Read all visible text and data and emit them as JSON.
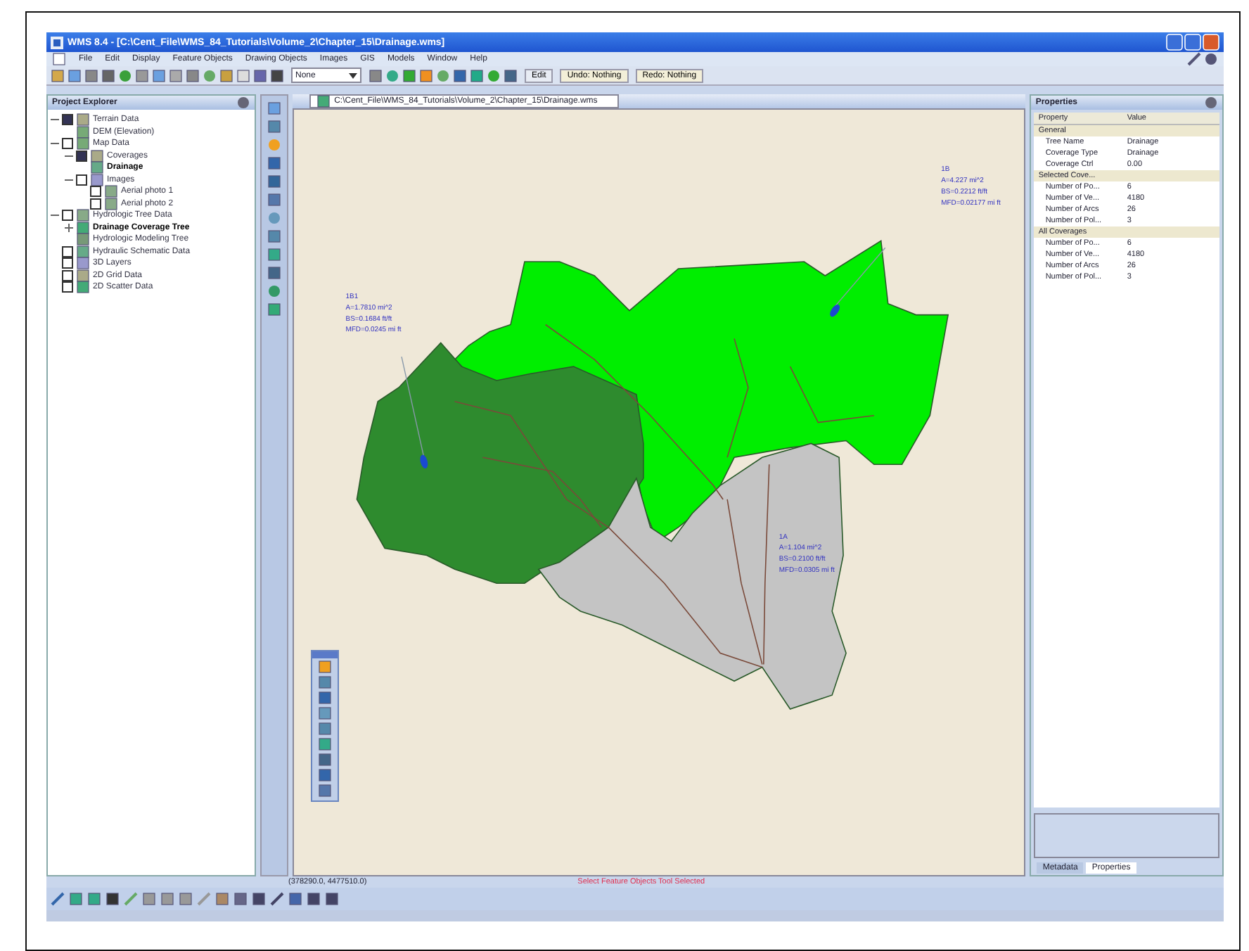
{
  "window": {
    "title": "WMS 8.4 - [C:\\Cent_File\\WMS_84_Tutorials\\Volume_2\\Chapter_15\\Drainage.wms]"
  },
  "menu": [
    "File",
    "Edit",
    "Display",
    "Feature Objects",
    "Drawing Objects",
    "Images",
    "GIS",
    "Models",
    "Window",
    "Help"
  ],
  "toolbar": {
    "dropdown": {
      "value": "None"
    },
    "buttons": [
      "Edit",
      "Undo: Nothing",
      "Redo: Nothing"
    ]
  },
  "project_explorer": {
    "title": "Project Explorer",
    "items": [
      {
        "label": "Terrain Data",
        "checked": true,
        "expanded": true,
        "active": false,
        "children": [
          {
            "label": "DEM (Elevation)",
            "active": false
          }
        ]
      },
      {
        "label": "Map Data",
        "checked": false,
        "expanded": true,
        "active": false,
        "children": [
          {
            "label": "Coverages",
            "checked": true,
            "expanded": true,
            "active": false,
            "children": [
              {
                "label": "Drainage",
                "active": true
              }
            ]
          },
          {
            "label": "Images",
            "checked": false,
            "expanded": true,
            "active": false,
            "children": [
              {
                "label": "Aerial photo 1",
                "checked": false,
                "active": false
              },
              {
                "label": "Aerial photo 2",
                "checked": false,
                "active": false
              }
            ]
          }
        ]
      },
      {
        "label": "Hydrologic Tree Data",
        "checked": false,
        "expanded": true,
        "active": false,
        "children": [
          {
            "label": "Drainage Coverage Tree",
            "expanded": false,
            "active": true
          },
          {
            "label": "Hydrologic Modeling Tree",
            "active": false
          }
        ]
      },
      {
        "label": "Hydraulic Schematic Data",
        "checked": false,
        "active": false
      },
      {
        "label": "3D Layers",
        "checked": false,
        "active": false
      },
      {
        "label": "2D Grid Data",
        "checked": false,
        "active": false
      },
      {
        "label": "2D Scatter Data",
        "checked": false,
        "active": false
      }
    ]
  },
  "document_tab": {
    "label": "C:\\Cent_File\\WMS_84_Tutorials\\Volume_2\\Chapter_15\\Drainage.wms"
  },
  "watersheds": [
    {
      "color": "#00ee00",
      "label": [
        "1B",
        "A=4.227 mi^2",
        "BS=0.2212 ft/ft",
        "MFD=0.02177 mi ft"
      ]
    },
    {
      "color": "#2e8b2e",
      "label": [
        "1B1",
        "A=1.7810 mi^2",
        "BS=0.1684 ft/ft",
        "MFD=0.0245 mi ft"
      ]
    },
    {
      "color": "#c4c4c4",
      "label": [
        "1A",
        "A=1.104 mi^2",
        "BS=0.2100 ft/ft",
        "MFD=0.0305 mi ft"
      ]
    }
  ],
  "properties": {
    "title": "Properties",
    "columns": [
      "Property",
      "Value"
    ],
    "rows": [
      {
        "kind": "header",
        "name": "General"
      },
      {
        "kind": "row",
        "name": "Tree Name",
        "value": "Drainage"
      },
      {
        "kind": "row",
        "name": "Coverage Type",
        "value": "Drainage"
      },
      {
        "kind": "row",
        "name": "Coverage Ctrl",
        "value": "0.00"
      },
      {
        "kind": "header",
        "name": "Selected Cove..."
      },
      {
        "kind": "row",
        "name": "Number of Po...",
        "value": "6"
      },
      {
        "kind": "row",
        "name": "Number of Ve...",
        "value": "4180"
      },
      {
        "kind": "row",
        "name": "Number of Arcs",
        "value": "26"
      },
      {
        "kind": "row",
        "name": "Number of Pol...",
        "value": "3"
      },
      {
        "kind": "header",
        "name": "All Coverages"
      },
      {
        "kind": "row",
        "name": "Number of Po...",
        "value": "6"
      },
      {
        "kind": "row",
        "name": "Number of Ve...",
        "value": "4180"
      },
      {
        "kind": "row",
        "name": "Number of Arcs",
        "value": "26"
      },
      {
        "kind": "row",
        "name": "Number of Pol...",
        "value": "3"
      }
    ],
    "tabs": [
      {
        "label": "Metadata",
        "selected": false
      },
      {
        "label": "Properties",
        "selected": true
      }
    ]
  },
  "status_bar": {
    "coordinates": "(378290.0, 4477510.0)",
    "message": "Select Feature Objects Tool Selected"
  }
}
